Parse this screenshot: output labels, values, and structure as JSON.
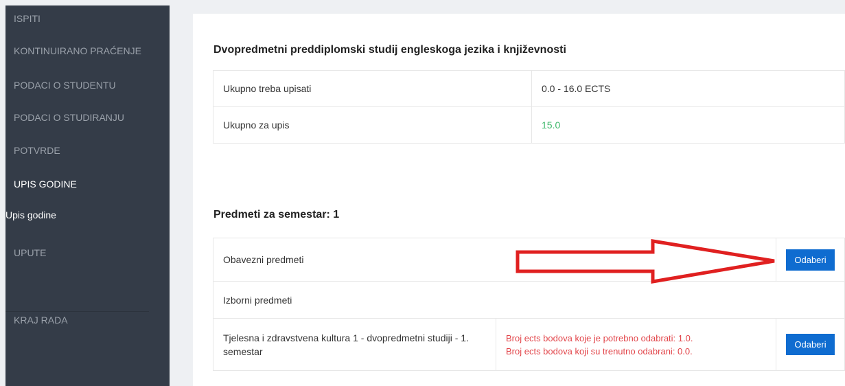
{
  "sidebar": {
    "items": [
      {
        "label": "ISPITI"
      },
      {
        "label": "KONTINUIRANO PRAĆENJE"
      },
      {
        "label": "PODACI O STUDENTU"
      },
      {
        "label": "PODACI O STUDIRANJU"
      },
      {
        "label": "POTVRDE"
      },
      {
        "label": "UPIS GODINE"
      },
      {
        "label": "Upis godine"
      },
      {
        "label": "UPUTE"
      },
      {
        "label": "KRAJ RADA"
      }
    ]
  },
  "main": {
    "program_title": "Dvopredmetni preddiplomski studij engleskoga jezika i književnosti",
    "summary": [
      {
        "label": "Ukupno treba upisati",
        "value": "0.0 - 16.0 ECTS"
      },
      {
        "label": "Ukupno za upis",
        "value": "15.0"
      }
    ],
    "semester_title": "Predmeti za semestar: 1",
    "mandatory": {
      "label": "Obavezni predmeti",
      "button": "Odaberi"
    },
    "elective_header": "Izborni predmeti",
    "elective": {
      "name": "Tjelesna i zdravstvena kultura 1 - dvopredmetni studiji - 1. semestar",
      "required": "Broj ects bodova koje je potrebno odabrati: 1.0.",
      "selected": "Broj ects bodova koji su trenutno odabrani: 0.0.",
      "button": "Odaberi"
    }
  },
  "colors": {
    "sidebar_bg": "#343c48",
    "accent_button": "#0f6cd0",
    "value_green": "#3fb86b",
    "warning_red": "#e2454a",
    "annotation_arrow": "#e02020"
  }
}
